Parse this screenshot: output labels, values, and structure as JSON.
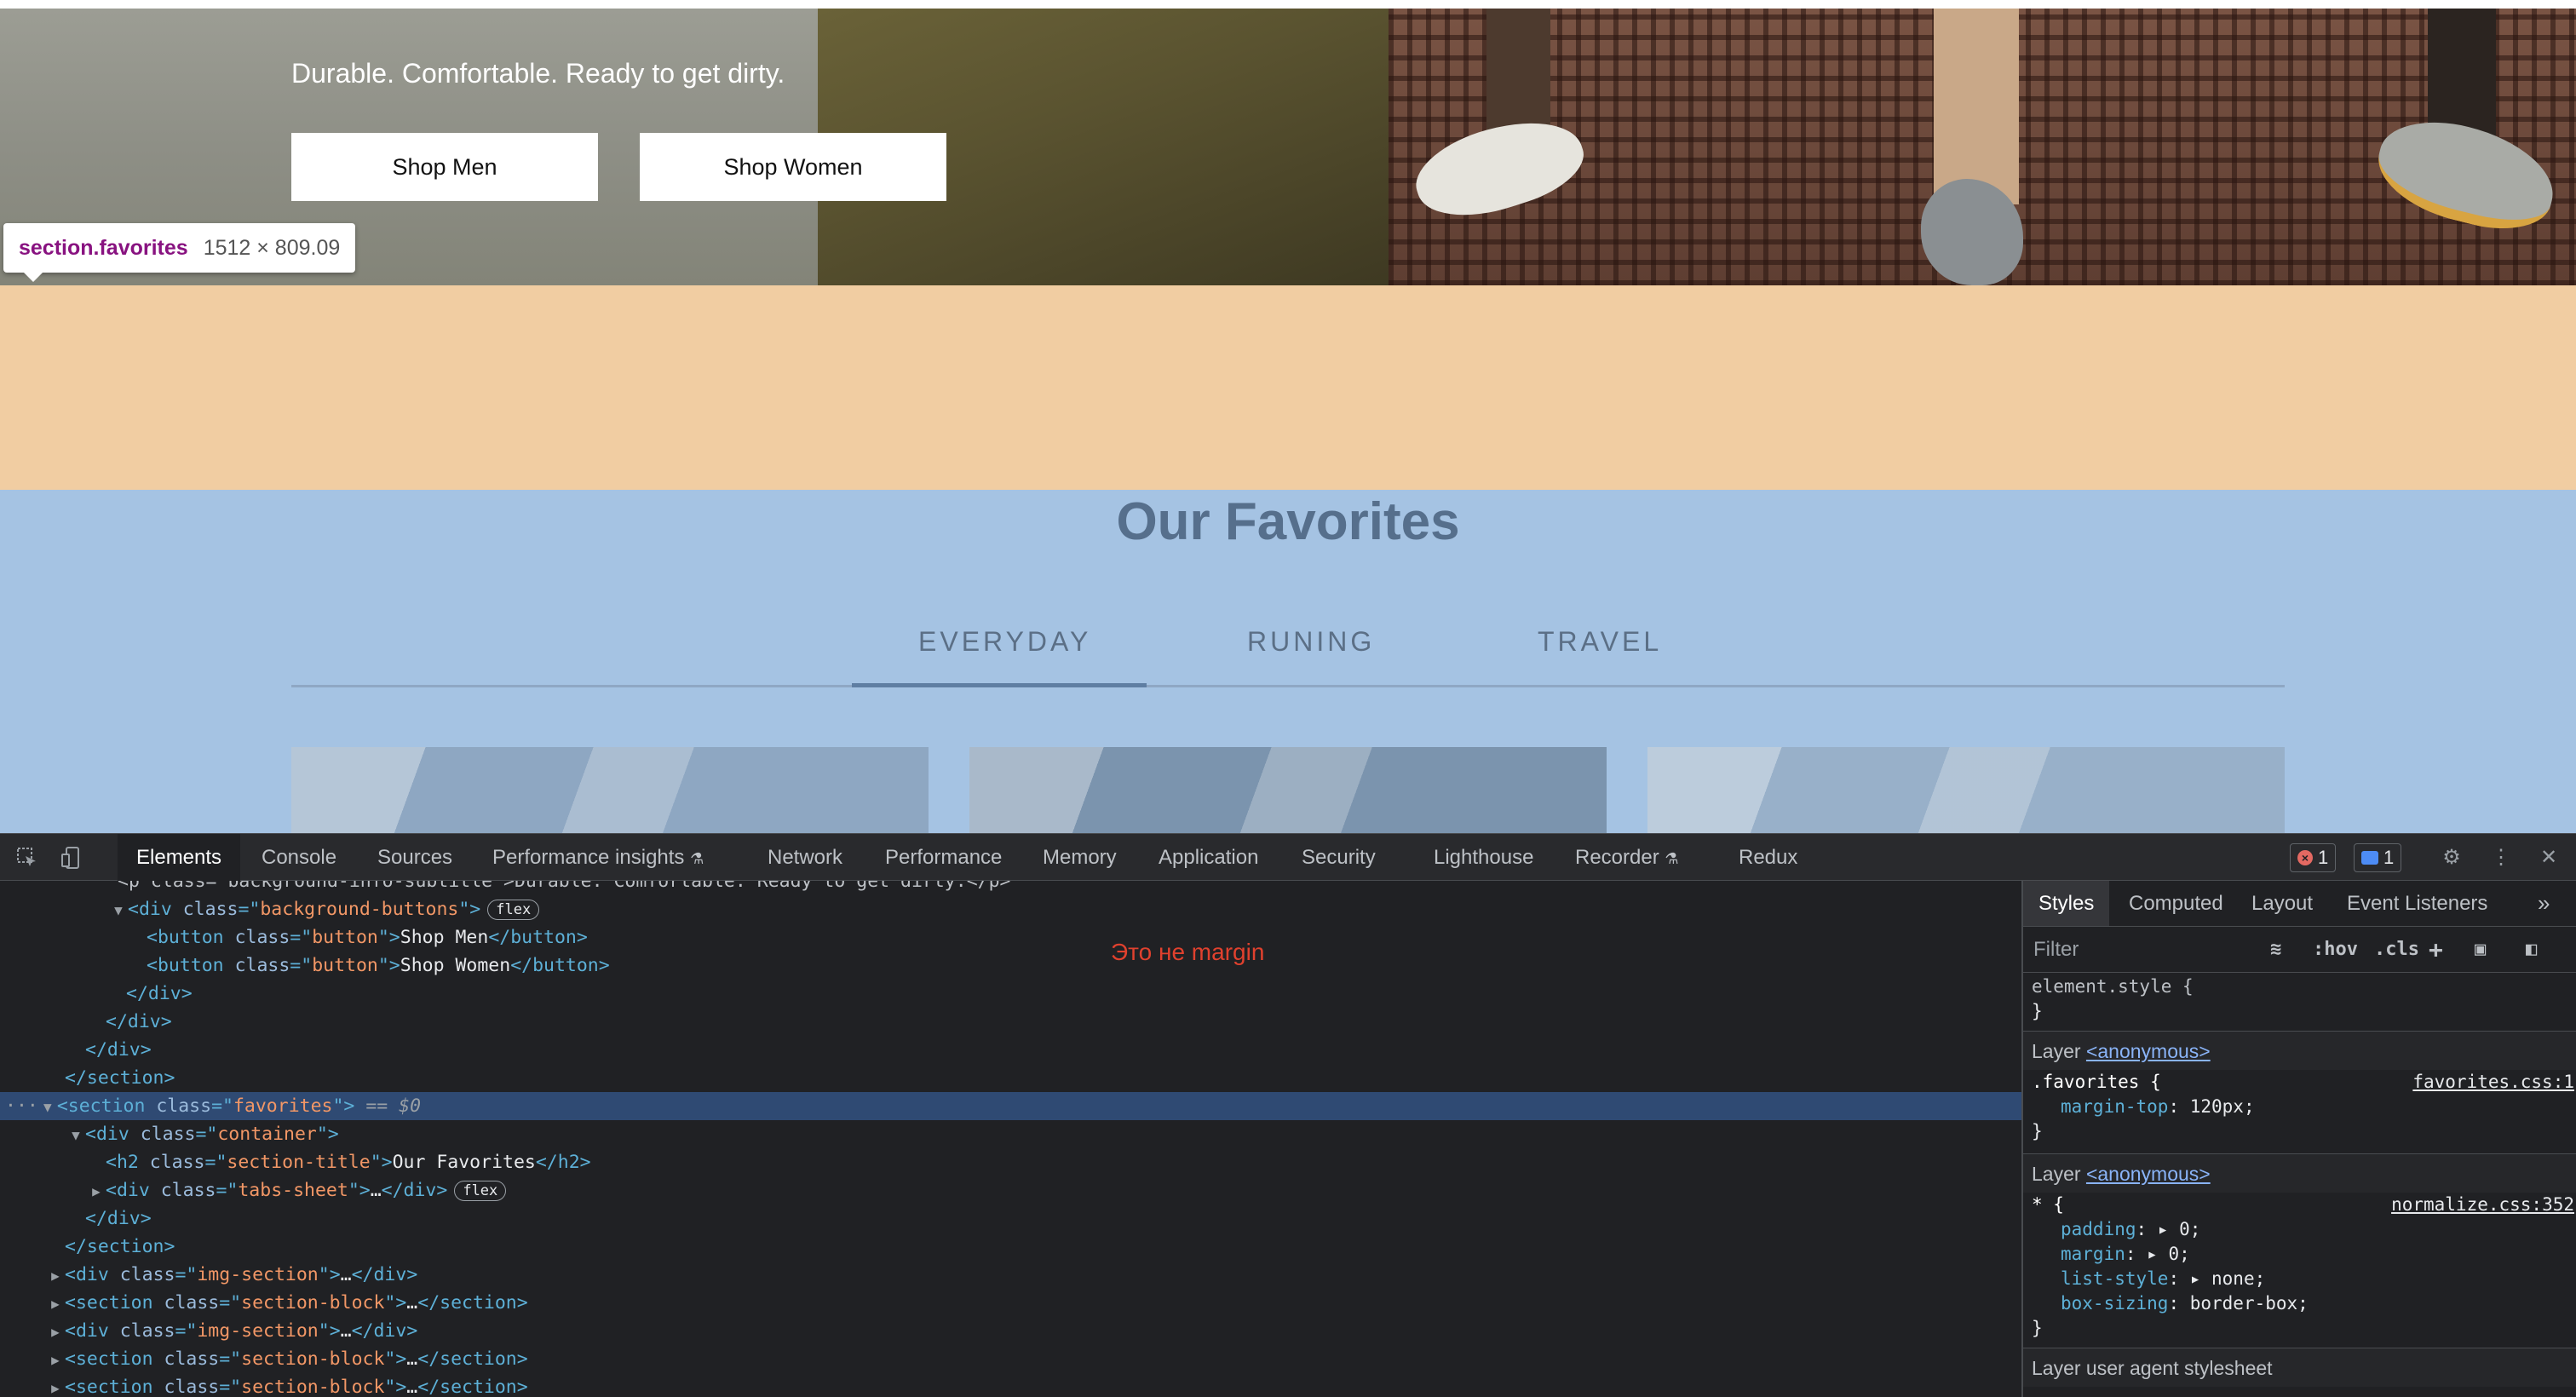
{
  "page": {
    "hero_text": "Durable. Comfortable. Ready to get dirty.",
    "shop_men_label": "Shop Men",
    "shop_women_label": "Shop Women"
  },
  "inspect_tooltip": {
    "selector": "section.favorites",
    "dimensions": "1512 × 809.09"
  },
  "favorites": {
    "title": "Our Favorites",
    "tabs": [
      "EVERYDAY",
      "RUNING",
      "TRAVEL"
    ],
    "active_tab": "EVERYDAY"
  },
  "devtools": {
    "tabs": [
      "Elements",
      "Console",
      "Sources",
      "Performance insights",
      "Network",
      "Performance",
      "Memory",
      "Application",
      "Security",
      "Lighthouse",
      "Recorder",
      "Redux"
    ],
    "active_tab": "Elements",
    "error_count": "1",
    "message_count": "1",
    "annotation": "Это не margin",
    "dom_partial_line": "<p class=\"background-info-subtitle\">Durable. Comfortable. Ready to get dirty.</p>",
    "dom_labels": {
      "flex": "flex",
      "selected_suffix": "== $0",
      "ellipsis": "…"
    },
    "dom_values": {
      "background_buttons": "background-buttons",
      "button": "button",
      "shop_men": "Shop Men",
      "shop_women": "Shop Women",
      "favorites": "favorites",
      "container": "container",
      "section_title": "section-title",
      "our_favorites": "Our Favorites",
      "tabs_sheet": "tabs-sheet",
      "img_section": "img-section",
      "section_block": "section-block"
    },
    "styles": {
      "tabs": [
        "Styles",
        "Computed",
        "Layout",
        "Event Listeners"
      ],
      "active_tab": "Styles",
      "filter_placeholder": "Filter",
      "hov_label": ":hov",
      "cls_label": ".cls",
      "element_style": "element.style {",
      "close_brace": "}",
      "layer_prefix": "Layer",
      "layer_anonymous": "<anonymous>",
      "rule1": {
        "selector": ".favorites {",
        "source": "favorites.css:1",
        "props": [
          {
            "name": "margin-top",
            "value": "120px;"
          }
        ]
      },
      "rule2": {
        "selector": "* {",
        "source": "normalize.css:352",
        "props": [
          {
            "name": "padding",
            "value": "0;"
          },
          {
            "name": "margin",
            "value": "0;"
          },
          {
            "name": "list-style",
            "value": "none;"
          },
          {
            "name": "box-sizing",
            "value": "border-box;"
          }
        ]
      },
      "user_agent_layer": "Layer user agent stylesheet"
    }
  }
}
